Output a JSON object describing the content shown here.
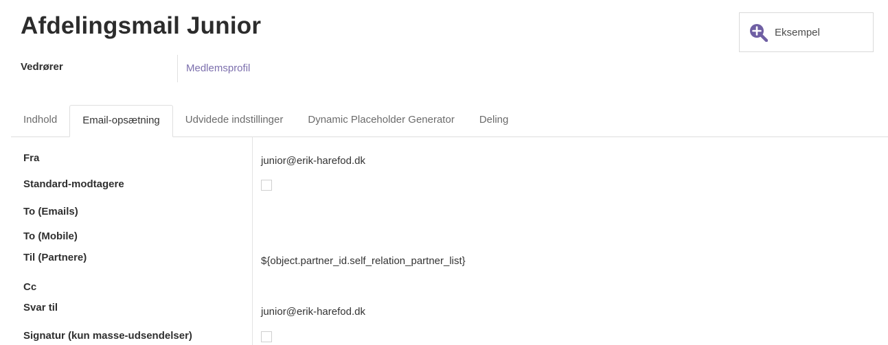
{
  "header": {
    "title": "Afdelingsmail Junior",
    "preview_button": {
      "icon": "zoom-in-icon",
      "label": "Eksempel"
    }
  },
  "subject": {
    "label": "Vedrører",
    "value": "Medlemsprofil"
  },
  "tabs": [
    {
      "label": "Indhold",
      "active": false
    },
    {
      "label": "Email-opsætning",
      "active": true
    },
    {
      "label": "Udvidede indstillinger",
      "active": false
    },
    {
      "label": "Dynamic Placeholder Generator",
      "active": false
    },
    {
      "label": "Deling",
      "active": false
    }
  ],
  "fields": {
    "from": {
      "label": "Fra",
      "value": "junior@erik-harefod.dk"
    },
    "default_recipients": {
      "label": "Standard-modtagere",
      "checked": false
    },
    "to_emails": {
      "label": "To (Emails)",
      "value": ""
    },
    "to_mobile": {
      "label": "To (Mobile)",
      "value": ""
    },
    "to_partners": {
      "label": "Til (Partnere)",
      "value": "${object.partner_id.self_relation_partner_list}"
    },
    "cc": {
      "label": "Cc",
      "value": ""
    },
    "reply_to": {
      "label": "Svar til",
      "value": "junior@erik-harefod.dk"
    },
    "signature": {
      "label": "Signatur (kun masse-udsendelser)",
      "checked": false
    }
  },
  "colors": {
    "accent": "#7c6fad",
    "icon": "#6f5fa3"
  }
}
